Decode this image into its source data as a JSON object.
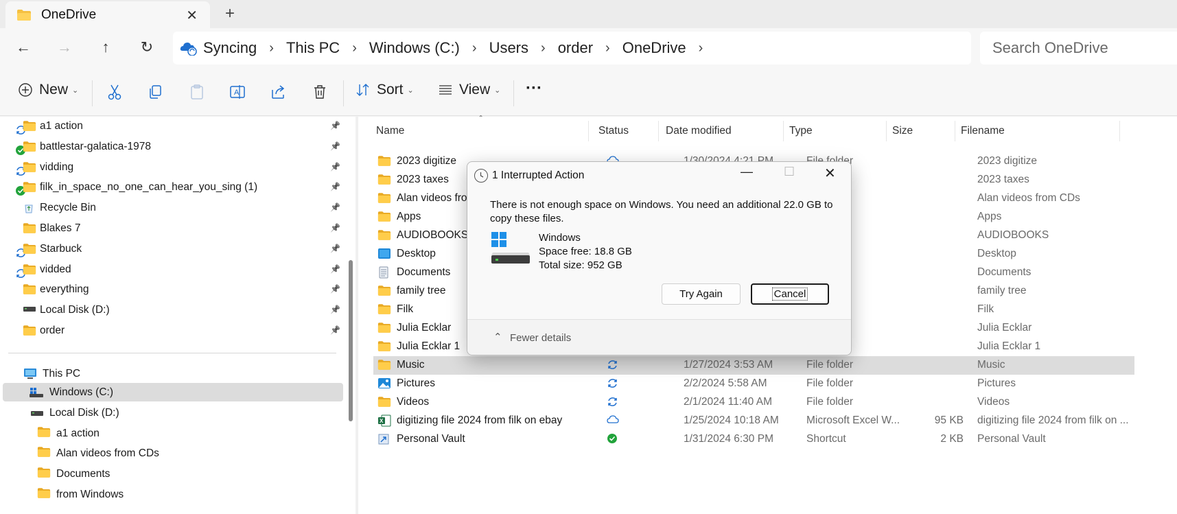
{
  "tab": {
    "title": "OneDrive",
    "close": "✕",
    "new_tab": "+"
  },
  "breadcrumb": [
    "Syncing",
    "This PC",
    "Windows (C:)",
    "Users",
    "order",
    "OneDrive"
  ],
  "search": {
    "placeholder": "Search OneDrive"
  },
  "toolbar": {
    "new_label": "New",
    "sort_label": "Sort",
    "view_label": "View",
    "more_label": "···"
  },
  "nav_pane": {
    "quick_access": [
      {
        "label": "a1 action",
        "icon": "folder-icon",
        "status": "sync"
      },
      {
        "label": "battlestar-galatica-1978",
        "icon": "folder-icon",
        "status": "ok"
      },
      {
        "label": "vidding",
        "icon": "folder-icon",
        "status": "sync"
      },
      {
        "label": "filk_in_space_no_one_can_hear_you_sing (1)",
        "icon": "folder-icon",
        "status": "ok"
      },
      {
        "label": "Recycle Bin",
        "icon": "recycle-bin-icon",
        "status": ""
      },
      {
        "label": "Blakes 7",
        "icon": "folder-icon",
        "status": ""
      },
      {
        "label": "Starbuck",
        "icon": "folder-icon",
        "status": "sync"
      },
      {
        "label": "vidded",
        "icon": "folder-icon",
        "status": "sync"
      },
      {
        "label": "everything",
        "icon": "folder-icon",
        "status": ""
      },
      {
        "label": "Local Disk (D:)",
        "icon": "drive-icon",
        "status": ""
      },
      {
        "label": "order",
        "icon": "folder-icon",
        "status": ""
      }
    ],
    "this_pc": "This PC",
    "drives": [
      {
        "label": "Windows (C:)",
        "indent": 1
      },
      {
        "label": "Local Disk (D:)",
        "indent": 1
      }
    ],
    "sub_folders": [
      "a1 action",
      "Alan videos from CDs",
      "Documents",
      "from Windows"
    ]
  },
  "columns": [
    "Name",
    "Status",
    "Date modified",
    "Type",
    "Size",
    "Filename"
  ],
  "files": [
    {
      "name": "2023 digitize",
      "icon": "folder-icon",
      "status": "cloud",
      "date": "1/30/2024 4:21 PM",
      "type": "File folder",
      "size": "",
      "filename": "2023 digitize"
    },
    {
      "name": "2023 taxes",
      "icon": "folder-icon",
      "status": "",
      "date": "",
      "type": "",
      "size": "",
      "filename": "2023 taxes"
    },
    {
      "name": "Alan videos from",
      "icon": "folder-icon",
      "status": "",
      "date": "",
      "type": "",
      "size": "",
      "filename": "Alan videos from CDs"
    },
    {
      "name": "Apps",
      "icon": "folder-icon",
      "status": "",
      "date": "",
      "type": "",
      "size": "",
      "filename": "Apps"
    },
    {
      "name": "AUDIOBOOKS",
      "icon": "folder-icon",
      "status": "",
      "date": "",
      "type": "",
      "size": "",
      "filename": "AUDIOBOOKS"
    },
    {
      "name": "Desktop",
      "icon": "desktop-icon",
      "status": "",
      "date": "",
      "type": "",
      "size": "",
      "filename": "Desktop"
    },
    {
      "name": "Documents",
      "icon": "documents-icon",
      "status": "",
      "date": "",
      "type": "",
      "size": "",
      "filename": "Documents"
    },
    {
      "name": "family tree",
      "icon": "folder-icon",
      "status": "",
      "date": "",
      "type": "",
      "size": "",
      "filename": "family tree"
    },
    {
      "name": "Filk",
      "icon": "folder-icon",
      "status": "",
      "date": "",
      "type": "",
      "size": "",
      "filename": "Filk"
    },
    {
      "name": "Julia Ecklar",
      "icon": "folder-icon",
      "status": "",
      "date": "",
      "type": "",
      "size": "",
      "filename": "Julia Ecklar"
    },
    {
      "name": "Julia Ecklar 1",
      "icon": "folder-icon",
      "status": "",
      "date": "",
      "type": "",
      "size": "",
      "filename": "Julia Ecklar 1"
    },
    {
      "name": "Music",
      "icon": "folder-icon",
      "status": "sync",
      "date": "1/27/2024 3:53 AM",
      "type": "File folder",
      "size": "",
      "filename": "Music",
      "selected": true
    },
    {
      "name": "Pictures",
      "icon": "pictures-icon",
      "status": "sync",
      "date": "2/2/2024 5:58 AM",
      "type": "File folder",
      "size": "",
      "filename": "Pictures"
    },
    {
      "name": "Videos",
      "icon": "folder-icon",
      "status": "sync",
      "date": "2/1/2024 11:40 AM",
      "type": "File folder",
      "size": "",
      "filename": "Videos"
    },
    {
      "name": "digitizing file 2024 from filk on ebay",
      "icon": "excel-icon",
      "status": "cloud",
      "date": "1/25/2024 10:18 AM",
      "type": "Microsoft Excel W...",
      "size": "95 KB",
      "filename": "digitizing file 2024 from filk on ..."
    },
    {
      "name": "Personal Vault",
      "icon": "shortcut-icon",
      "status": "ok",
      "date": "1/31/2024 6:30 PM",
      "type": "Shortcut",
      "size": "2 KB",
      "filename": "Personal Vault"
    }
  ],
  "dialog": {
    "title": "1 Interrupted Action",
    "message": "There is not enough space on Windows. You need an additional 22.0 GB to copy these files.",
    "drive_name": "Windows",
    "space_free": "Space free: 18.8 GB",
    "total_size": "Total size: 952 GB",
    "try_again": "Try Again",
    "cancel": "Cancel",
    "fewer_details": "Fewer details"
  },
  "colors": {
    "folder": "#f5c042",
    "sync_blue": "#1f6fcf",
    "ok_green": "#22a33b",
    "selection": "#dcdcdc"
  }
}
